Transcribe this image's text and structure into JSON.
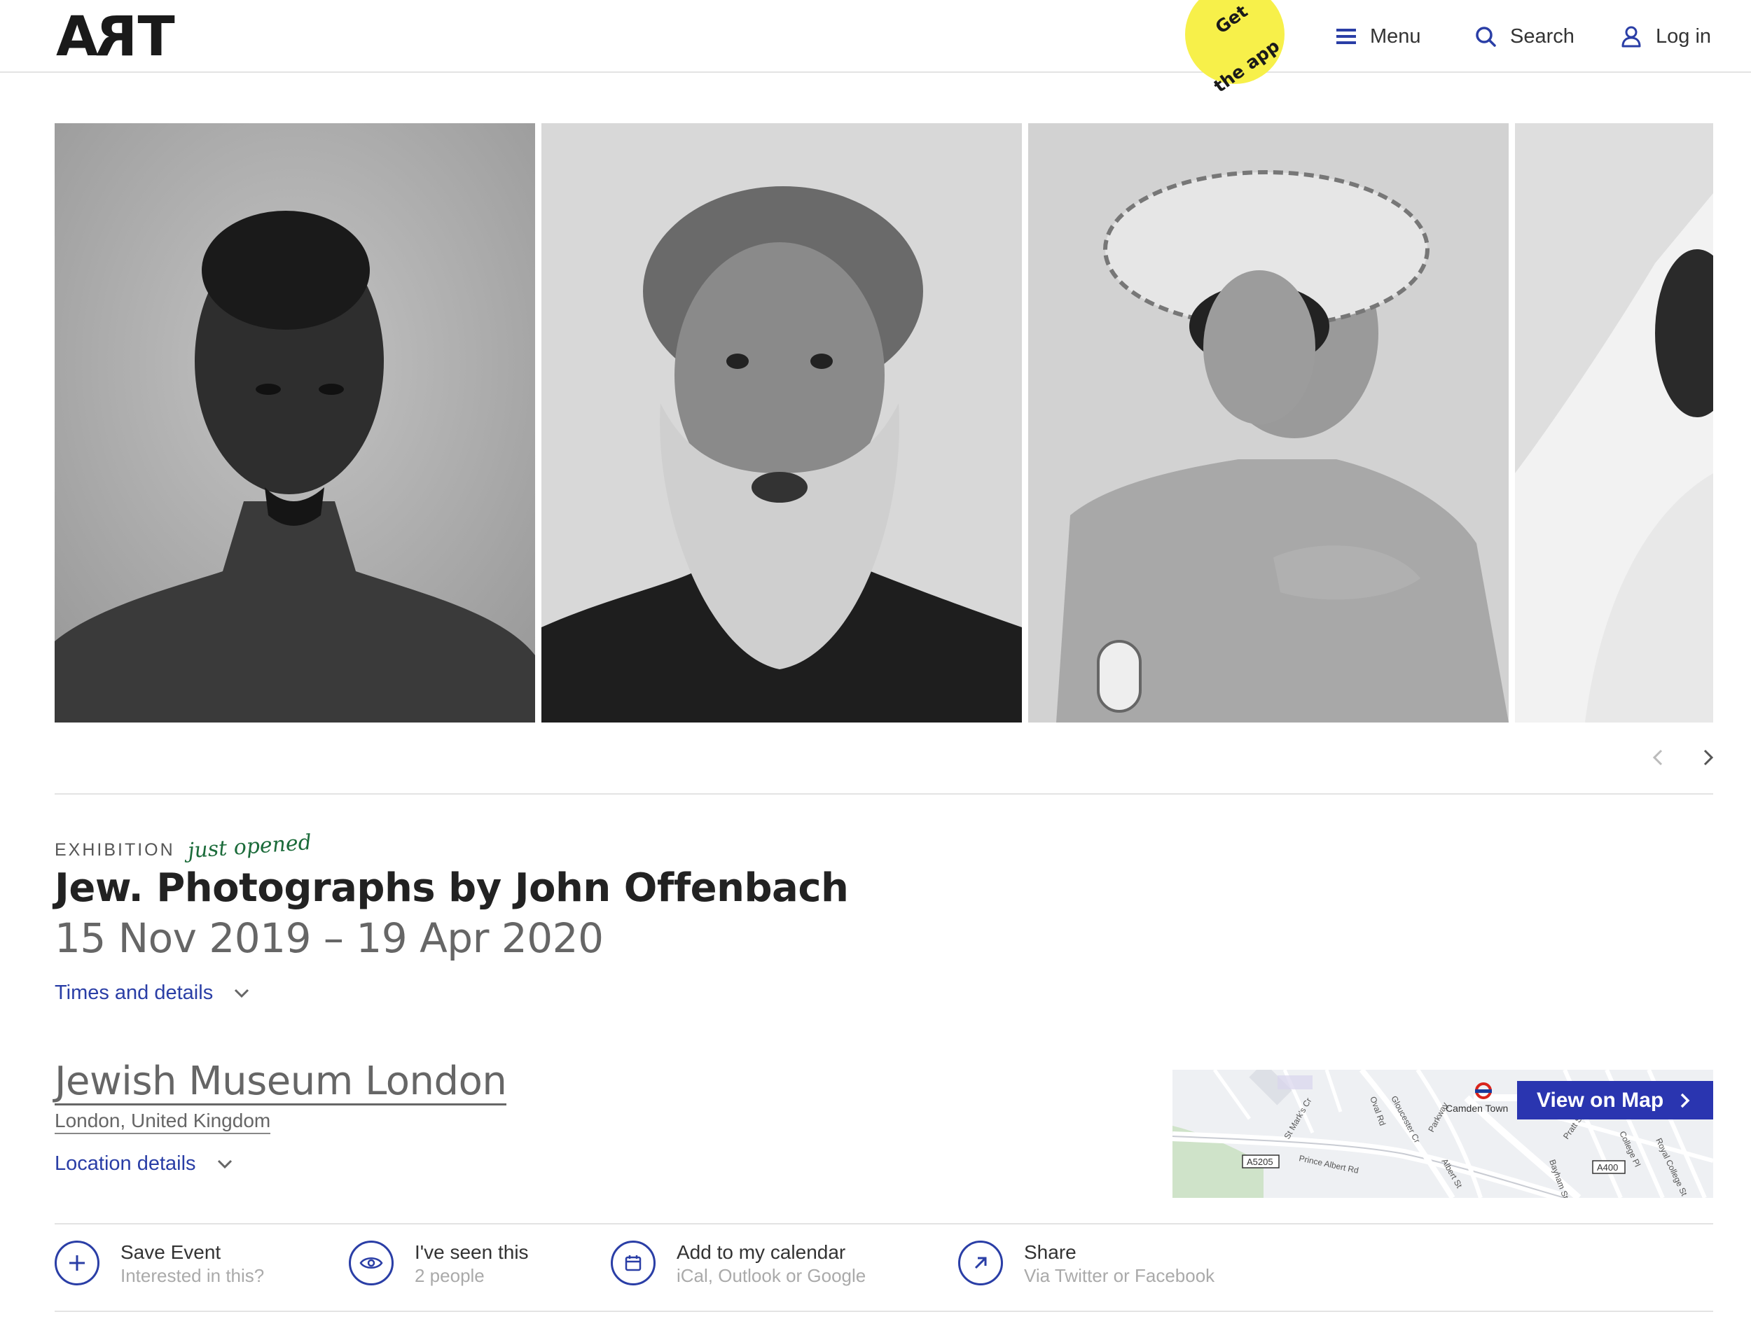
{
  "header": {
    "logo": "ART",
    "app_badge": "Get the app",
    "app_badge_line1": "Get",
    "app_badge_line2": "the app",
    "menu_label": "Menu",
    "search_label": "Search",
    "login_label": "Log in"
  },
  "gallery": {
    "photos": [
      "portrait-young-man",
      "portrait-bearded-man",
      "portrait-woman-paper-hat",
      "portrait-veiled-man"
    ]
  },
  "event": {
    "type": "EXHIBITION",
    "tag": "just opened",
    "title": "Jew. Photographs by John Offenbach",
    "dates": "15 Nov 2019 – 19 Apr 2020",
    "times_link": "Times and details"
  },
  "venue": {
    "name": "Jewish Museum London",
    "location": "London, United Kingdom",
    "location_link": "Location details",
    "map_button": "View on Map",
    "map_labels": {
      "camden": "Camden Town",
      "a5205": "A5205",
      "a400": "A400",
      "prince_albert": "Prince Albert Rd",
      "oval": "Oval Rd",
      "parkway": "Parkway",
      "gloucester": "Gloucester Cr",
      "st_marks": "St Mark's Cr",
      "pratt": "Pratt St",
      "college": "College Pl",
      "royal_college": "Royal College St",
      "bayham": "Bayham St",
      "albert": "Albert St"
    }
  },
  "actions": [
    {
      "title": "Save Event",
      "subtitle": "Interested in this?"
    },
    {
      "title": "I've seen this",
      "subtitle": "2 people"
    },
    {
      "title": "Add to my calendar",
      "subtitle": "iCal, Outlook or Google"
    },
    {
      "title": "Share",
      "subtitle": "Via Twitter or Facebook"
    }
  ],
  "colors": {
    "accent": "#2a3ea6",
    "badge": "#f7f04a",
    "tag": "#1b6b3a"
  }
}
